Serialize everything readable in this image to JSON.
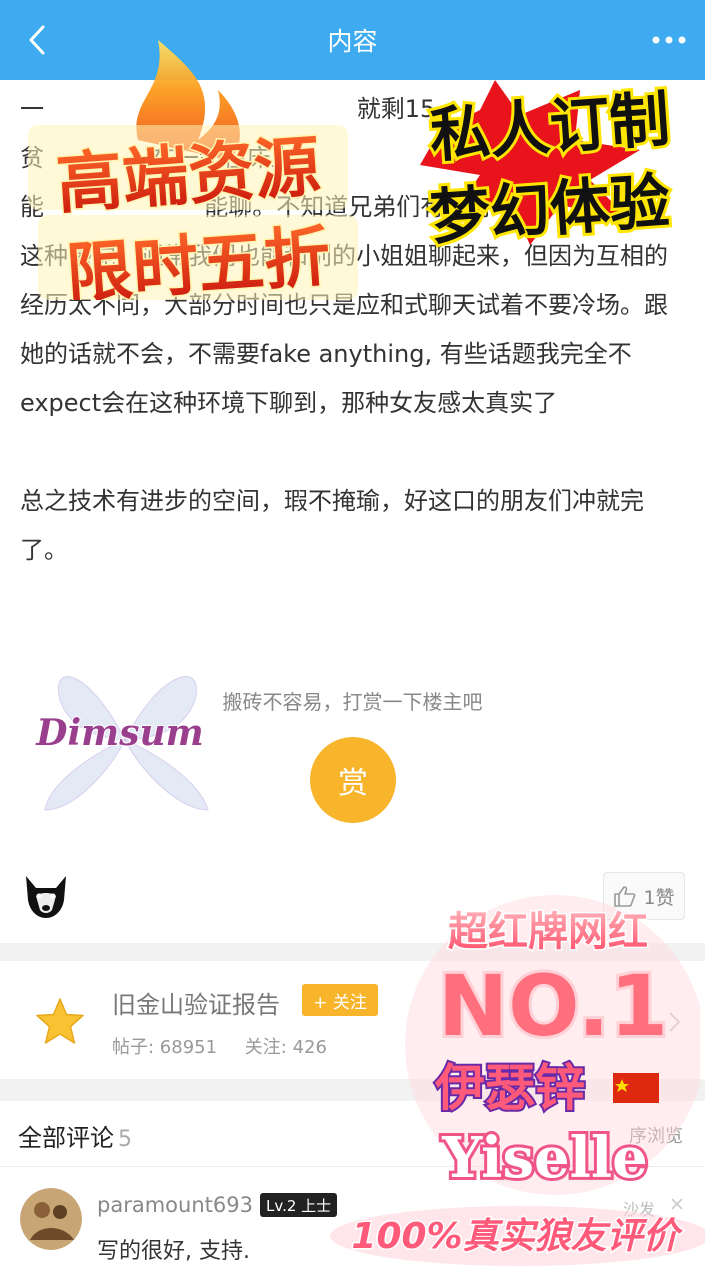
{
  "nav": {
    "title": "内容"
  },
  "article": {
    "line_partial_1": "一                                         就剩15",
    "line_partial_2": "贫              在一起在床上",
    "line_partial_3": "能                     能聊。不知道兄弟们有没有",
    "paragraph_1": "这种感觉，通常我们也能和别的小姐姐聊起来，但因为互相的经历太不同，大部分时间也只是应和式聊天试着不要冷场。跟她的话就不会，不需要fake anything, 有些话题我完全不expect会在这种环境下聊到，那种女友感太真实了",
    "paragraph_2": "总之技术有进步的空间，瑕不掩瑜，好这口的朋友们冲就完了。"
  },
  "promo": {
    "top_left_line1": "高端资源",
    "top_left_line2": "限时五折",
    "top_right_line1": "私人订制",
    "top_right_line2": "梦幻体验",
    "right_line1": "超红牌网红",
    "right_line2": "NO.1",
    "right_line3": "伊瑟锌",
    "right_line4": "Yiselle",
    "bottom": "100%真实狼友评价",
    "watermark": "Dimsum"
  },
  "reward": {
    "hint": "搬砖不容易，打赏一下楼主吧",
    "button": "赏"
  },
  "like": {
    "label": "1赞"
  },
  "forum": {
    "name": "旧金山验证报告",
    "follow": "+ 关注",
    "posts": "帖子: 68951",
    "followers": "关注: 426"
  },
  "comments": {
    "title": "全部评论",
    "count": "5",
    "sort": "序浏览",
    "first": {
      "user": "paramount693",
      "level": "Lv.2 上士",
      "floor": "沙发",
      "text": "写的很好, 支持."
    }
  }
}
